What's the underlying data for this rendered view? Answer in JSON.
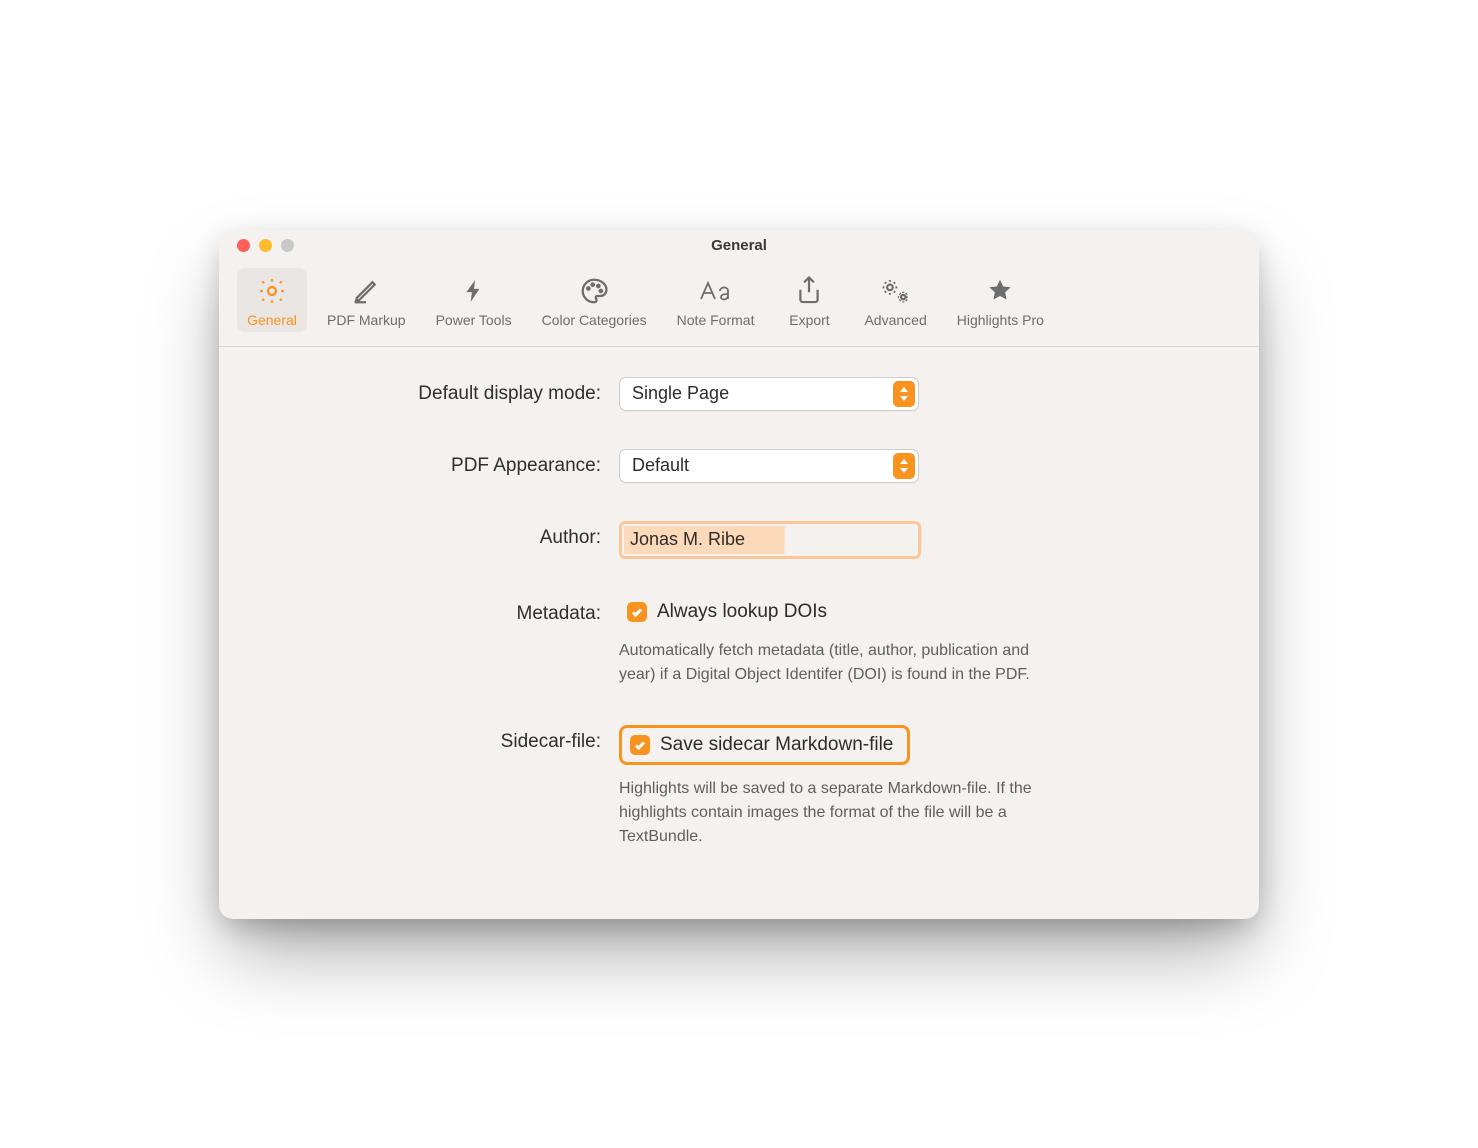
{
  "window": {
    "title": "General"
  },
  "toolbar": {
    "items": [
      {
        "id": "general",
        "label": "General"
      },
      {
        "id": "pdf-markup",
        "label": "PDF Markup"
      },
      {
        "id": "power-tools",
        "label": "Power Tools"
      },
      {
        "id": "color-categories",
        "label": "Color Categories"
      },
      {
        "id": "note-format",
        "label": "Note Format"
      },
      {
        "id": "export",
        "label": "Export"
      },
      {
        "id": "advanced",
        "label": "Advanced"
      },
      {
        "id": "highlights-pro",
        "label": "Highlights Pro"
      }
    ],
    "active_index": 0
  },
  "form": {
    "display_mode": {
      "label": "Default display mode:",
      "value": "Single Page"
    },
    "pdf_appearance": {
      "label": "PDF Appearance:",
      "value": "Default"
    },
    "author": {
      "label": "Author:",
      "value": "Jonas M. Ribe"
    },
    "metadata": {
      "label": "Metadata:",
      "checkbox_label": "Always lookup DOIs",
      "checked": true,
      "help": "Automatically fetch metadata (title, author, publication and year) if a Digital Object Identifer (DOI) is found in the PDF."
    },
    "sidecar": {
      "label": "Sidecar-file:",
      "checkbox_label": "Save sidecar Markdown-file",
      "checked": true,
      "help": "Highlights will be saved to a separate Markdown-file. If the highlights contain images the format of the file will be a TextBundle."
    }
  },
  "colors": {
    "accent": "#f7931e"
  }
}
